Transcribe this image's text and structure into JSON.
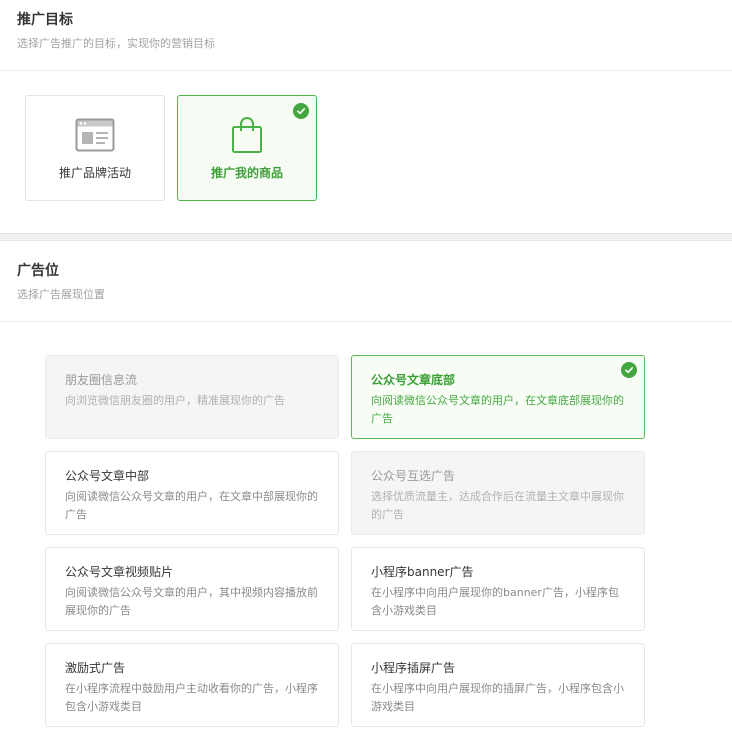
{
  "goal_section": {
    "title": "推广目标",
    "description": "选择广告推广的目标，实现你的营销目标",
    "options": [
      {
        "label": "推广品牌活动",
        "icon": "browser-window-icon",
        "selected": false
      },
      {
        "label": "推广我的商品",
        "icon": "shopping-bag-icon",
        "selected": true
      }
    ]
  },
  "placement_section": {
    "title": "广告位",
    "description": "选择广告展现位置",
    "slots": [
      {
        "title": "朋友圈信息流",
        "description": "向浏览微信朋友圈的用户，精准展现你的广告",
        "state": "disabled"
      },
      {
        "title": "公众号文章底部",
        "description": "向阅读微信公众号文章的用户，在文章底部展现你的广告",
        "state": "selected"
      },
      {
        "title": "公众号文章中部",
        "description": "向阅读微信公众号文章的用户，在文章中部展现你的广告",
        "state": "normal"
      },
      {
        "title": "公众号互选广告",
        "description": "选择优质流量主，达成合作后在流量主文章中展现你的广告",
        "state": "disabled"
      },
      {
        "title": "公众号文章视频贴片",
        "description": "向阅读微信公众号文章的用户，其中视频内容播放前展现你的广告",
        "state": "normal"
      },
      {
        "title": "小程序banner广告",
        "description": "在小程序中向用户展现你的banner广告，小程序包含小游戏类目",
        "state": "normal"
      },
      {
        "title": "激励式广告",
        "description": "在小程序流程中鼓励用户主动收看你的广告，小程序包含小游戏类目",
        "state": "normal"
      },
      {
        "title": "小程序插屏广告",
        "description": "在小程序中向用户展现你的插屏广告，小程序包含小游戏类目",
        "state": "normal"
      }
    ]
  },
  "colors": {
    "accent_green": "#43a63f",
    "selected_bg": "#f7fdf5",
    "disabled_bg": "#f4f5f7"
  }
}
